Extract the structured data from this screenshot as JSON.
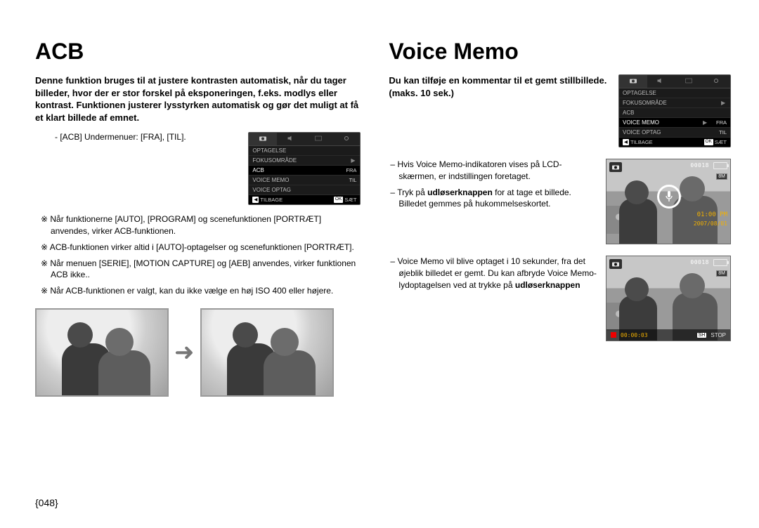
{
  "left": {
    "title": "ACB",
    "intro": "Denne funktion bruges til at justere kontrasten automatisk, når du tager billeder, hvor der er stor forskel på eksponeringen, f.eks. modlys eller kontrast. Funktionen justerer lysstyrken automatisk og gør det muligt at få et klart billede af emnet.",
    "submenu_line": "[ACB] Undermenuer: [FRA], [TIL].",
    "notes": [
      "Når funktionerne [AUTO], [PROGRAM] og scenefunktionen [PORTRÆT] anvendes, virker ACB-funktionen.",
      "ACB-funktionen virker altid i [AUTO]-optagelser og scenefunktionen [PORTRÆT].",
      "Når menuen [SERIE], [MOTION CAPTURE] og [AEB] anvendes, virker funktionen ACB ikke..",
      "Når ACB-funktionen er valgt, kan du ikke vælge en høj ISO 400 eller højere."
    ],
    "lcd": {
      "rows": [
        {
          "label": "OPTAGELSE",
          "arrow": "",
          "val": ""
        },
        {
          "label": "FOKUSOMRÅDE",
          "arrow": "▶",
          "val": ""
        },
        {
          "label": "ACB",
          "arrow": "",
          "val": "FRA",
          "hl": true
        },
        {
          "label": "VOICE MEMO",
          "arrow": "",
          "val": "TIL"
        },
        {
          "label": "VOICE OPTAG",
          "arrow": "",
          "val": ""
        }
      ],
      "foot_back_key": "◀",
      "foot_back": "TILBAGE",
      "foot_ok_key": "OK",
      "foot_ok": "SÆT"
    }
  },
  "right": {
    "title": "Voice Memo",
    "intro": "Du kan tilføje en kommentar til et gemt stillbillede. (maks. 10 sek.)",
    "lcd": {
      "rows": [
        {
          "label": "OPTAGELSE",
          "arrow": "",
          "val": ""
        },
        {
          "label": "FOKUSOMRÅDE",
          "arrow": "▶",
          "val": ""
        },
        {
          "label": "ACB",
          "arrow": "",
          "val": ""
        },
        {
          "label": "VOICE MEMO",
          "arrow": "▶",
          "val": "FRA",
          "hl": true
        },
        {
          "label": "VOICE OPTAG",
          "arrow": "",
          "val": "TIL"
        }
      ],
      "foot_back_key": "◀",
      "foot_back": "TILBAGE",
      "foot_ok_key": "OK",
      "foot_ok": "SÆT"
    },
    "block1": {
      "line1": "Hvis Voice Memo-indikatoren vises på LCD-skærmen, er indstillingen foretaget.",
      "line2a": "Tryk på ",
      "line2b": "udløserknappen",
      "line2c": " for at tage et billede. Billedet gemmes på hukommelseskortet."
    },
    "block2": {
      "line1": "Voice Memo vil blive optaget i 10 sekunder, fra det øjeblik billedet er gemt. Du kan afbryde Voice Memo-lydoptagelsen ved at trykke på ",
      "line1bold": "udløserknappen"
    },
    "shot": {
      "count": "00018",
      "size": "8M",
      "time": "01:00 PM",
      "date": "2007/08/01",
      "rec_timer": "00:00:03",
      "stop_key": "SH",
      "stop_label": "STOP"
    }
  },
  "page_num": "{048}"
}
